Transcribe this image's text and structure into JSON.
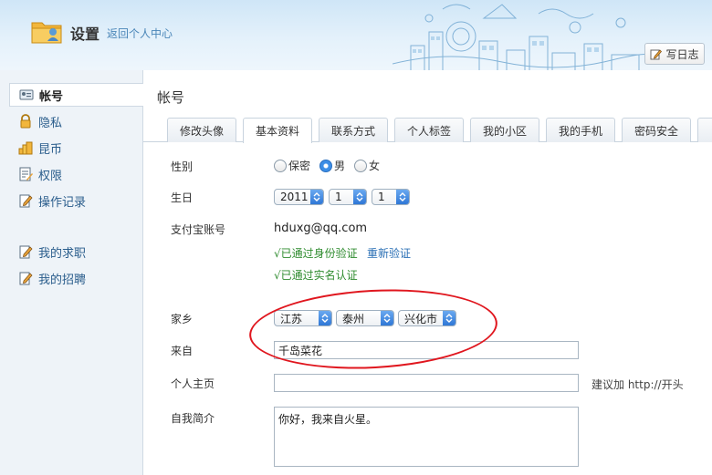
{
  "header": {
    "title": "设置",
    "back_link": "返回个人中心",
    "write_log": "写日志"
  },
  "sidebar": {
    "items": [
      {
        "label": "帐号",
        "icon": "id-card-icon"
      },
      {
        "label": "隐私",
        "icon": "lock-icon"
      },
      {
        "label": "昆币",
        "icon": "coins-icon"
      },
      {
        "label": "权限",
        "icon": "permission-icon"
      },
      {
        "label": "操作记录",
        "icon": "edit-record-icon"
      },
      {
        "label": "我的求职",
        "icon": "edit-job-icon"
      },
      {
        "label": "我的招聘",
        "icon": "edit-recruit-icon"
      }
    ]
  },
  "main": {
    "title": "帐号",
    "tabs": [
      "修改头像",
      "基本资料",
      "联系方式",
      "个人标签",
      "我的小区",
      "我的手机",
      "密码安全"
    ],
    "active_tab": "基本资料",
    "gender": {
      "label": "性别",
      "options": [
        "保密",
        "男",
        "女"
      ],
      "selected": "男"
    },
    "birthday": {
      "label": "生日",
      "year": "2011",
      "month": "1",
      "day": "1"
    },
    "alipay": {
      "label": "支付宝账号",
      "value": "hduxg@qq.com",
      "verified_id": "√已通过身份验证",
      "reverify": "重新验证",
      "verified_name": "√已通过实名认证"
    },
    "hometown": {
      "label": "家乡",
      "province": "江苏",
      "city": "泰州",
      "county": "兴化市"
    },
    "from": {
      "label": "来自",
      "value": "千岛菜花"
    },
    "homepage": {
      "label": "个人主页",
      "value": "",
      "hint": "建议加 http://开头"
    },
    "bio": {
      "label": "自我简介",
      "value": "你好，我来自火星。"
    }
  },
  "colors": {
    "link": "#4a86b8",
    "verified": "#2e8b2e",
    "highlight": "#e0161e",
    "select_arrow": "#2f77d6"
  }
}
